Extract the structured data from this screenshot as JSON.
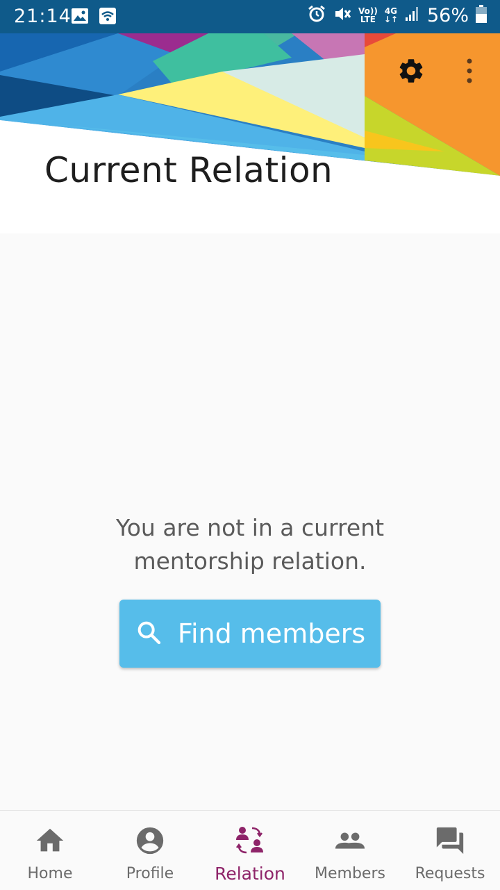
{
  "status_bar": {
    "time": "21:14",
    "volte_line1": "Vo))",
    "volte_line2": "LTE",
    "network_line1": "4G",
    "network_line2": "↓↑",
    "battery_percent": "56%"
  },
  "header": {
    "title": "Current Relation",
    "settings_icon": "gear-icon",
    "overflow_icon": "more-vert-icon"
  },
  "empty_state": {
    "line1": "You are not in a current",
    "line2": "mentorship relation.",
    "button_label": "Find members",
    "button_icon": "search-icon"
  },
  "bottom_nav": {
    "items": [
      {
        "label": "Home",
        "icon": "home-icon"
      },
      {
        "label": "Profile",
        "icon": "account-circle-icon"
      },
      {
        "label": "Relation",
        "icon": "relation-icon"
      },
      {
        "label": "Members",
        "icon": "group-icon"
      },
      {
        "label": "Requests",
        "icon": "forum-icon"
      }
    ],
    "active_index": 2
  },
  "colors": {
    "status_bar": "#0f5a8a",
    "accent": "#8e2469",
    "button": "#56bdea",
    "inactive": "#6b6b6b"
  }
}
